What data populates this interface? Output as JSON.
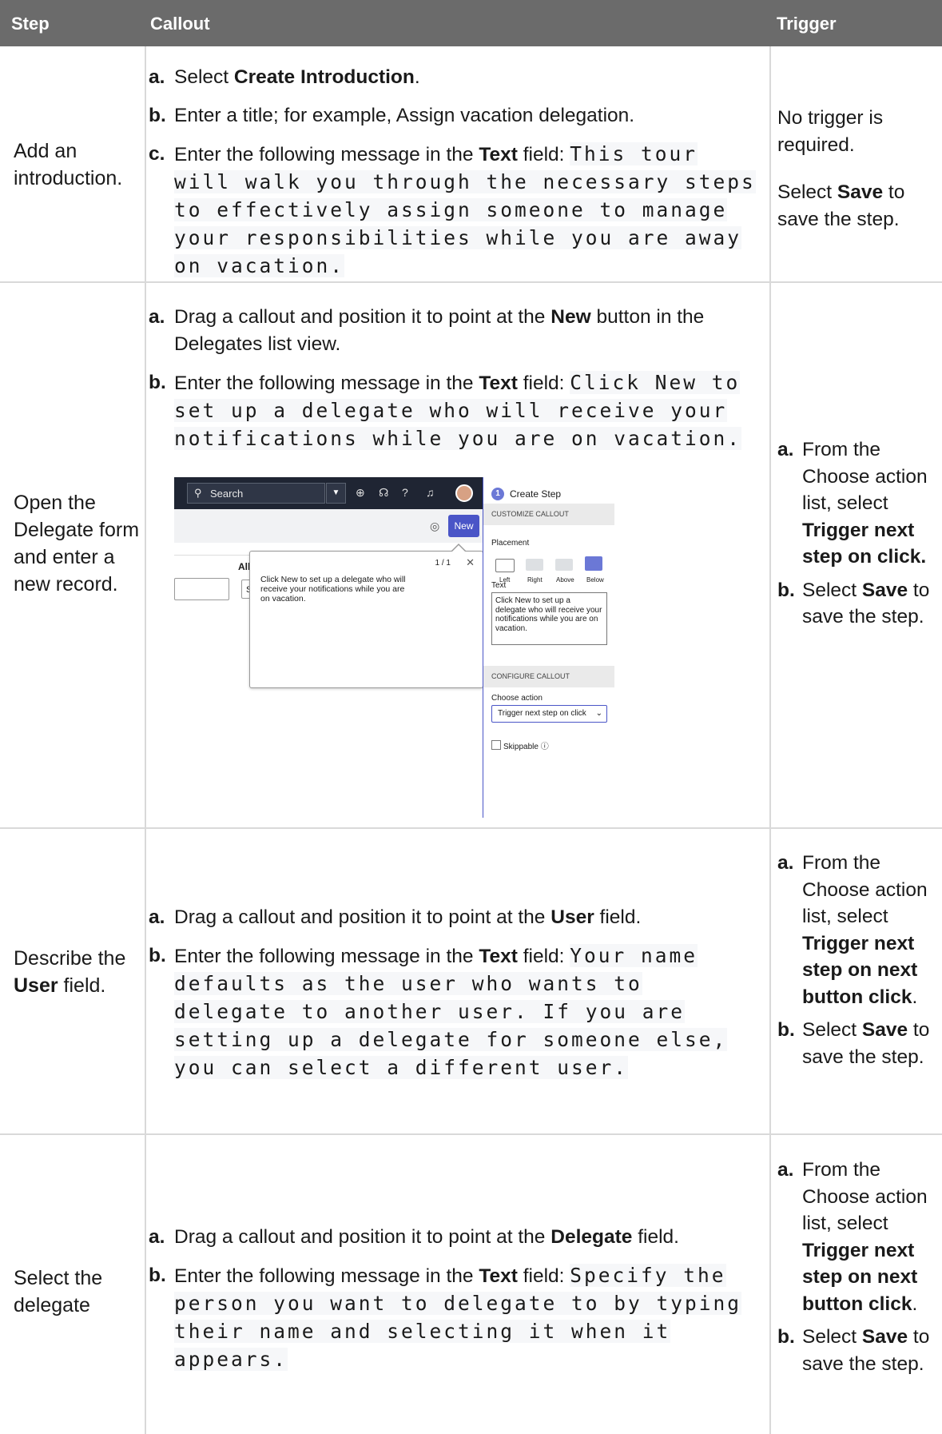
{
  "header": {
    "step": "Step",
    "callout": "Callout",
    "trigger": "Trigger"
  },
  "rows": [
    {
      "step": "Add an introduction.",
      "callout": [
        {
          "label": "a.",
          "pre": "Select ",
          "bold": "Create Introduction",
          "post": "."
        },
        {
          "label": "b.",
          "pre": "Enter a title; for example, Assign vacation delegation."
        },
        {
          "label": "c.",
          "pre": "Enter the following message in the ",
          "bold": "Text",
          "post": " field: ",
          "code": "This tour will walk you through the necessary steps to effectively assign someone to manage your responsibilities while you are away on vacation."
        }
      ],
      "trigger": [
        {
          "text": "No trigger is required."
        },
        {
          "pre": "Select ",
          "bold": "Save",
          "post": " to save the step."
        }
      ]
    },
    {
      "step": "Open the Delegate form and enter a new record.",
      "callout": [
        {
          "label": "a.",
          "pre": "Drag a callout and position it to point at the ",
          "bold": "New",
          "post": " button in the Delegates list view."
        },
        {
          "label": "b.",
          "pre": "Enter the following message in the ",
          "bold": "Text",
          "post": " field: ",
          "code": "Click New to set up a delegate who will receive your notifications while you are on vacation."
        }
      ],
      "trigger": [
        {
          "label": "a.",
          "pre": "From the Choose action list, select ",
          "bold": "Trigger next step on click."
        },
        {
          "label": "b.",
          "pre": "Select ",
          "bold": "Save",
          "post": " to save the step."
        }
      ]
    },
    {
      "step_pre": "Describe the ",
      "step_bold": "User",
      "step_post": " field.",
      "callout": [
        {
          "label": "a.",
          "pre": "Drag a callout and position it to point at the ",
          "bold": "User",
          "post": " field."
        },
        {
          "label": "b.",
          "pre": "Enter the following message in the ",
          "bold": "Text",
          "post": " field: ",
          "code": "Your name defaults as the user who wants to delegate to another user. If you are setting up a delegate for someone else, you can select a different user."
        }
      ],
      "trigger": [
        {
          "label": "a.",
          "pre": "From the Choose action list, select ",
          "bold": "Trigger next step on next button click",
          "post": "."
        },
        {
          "label": "b.",
          "pre": "Select ",
          "bold": "Save",
          "post": " to save the step."
        }
      ]
    },
    {
      "step": "Select the delegate",
      "callout": [
        {
          "label": "a.",
          "pre": "Drag a callout and position it to point at the ",
          "bold": "Delegate",
          "post": " field."
        },
        {
          "label": "b.",
          "pre": "Enter the following message in the ",
          "bold": "Text",
          "post": " field: ",
          "code": "Specify the person you want to delegate to by typing their name and selecting it when it appears."
        }
      ],
      "trigger": [
        {
          "label": "a.",
          "pre": "From the Choose action list, select ",
          "bold": "Trigger next step on next button click",
          "post": "."
        },
        {
          "label": "b.",
          "pre": "Select ",
          "bold": "Save",
          "post": " to save the step."
        }
      ]
    }
  ],
  "screenshot": {
    "search_placeholder": "Search",
    "new_button": "New",
    "list_heading": "All notificat",
    "list_search": "Search",
    "tooltip_count": "1 / 1",
    "tooltip_close": "✕",
    "tooltip_text": "Click New to set up a delegate who will receive your notifications while you are on vacation.",
    "panel_step_number": "1",
    "panel_title": "Create Step",
    "customize_heading": "CUSTOMIZE CALLOUT",
    "placement_label": "Placement",
    "placements": [
      "Left",
      "Right",
      "Above",
      "Below"
    ],
    "selected_placement": "Below",
    "text_label": "Text",
    "text_value": "Click New to set up a delegate who will receive your notifications while you are on vacation.",
    "configure_heading": "CONFIGURE CALLOUT",
    "choose_action_label": "Choose action",
    "choose_action_value": "Trigger next step on click",
    "skippable_label": "Skippable",
    "accent_color": "#4a55c7"
  }
}
